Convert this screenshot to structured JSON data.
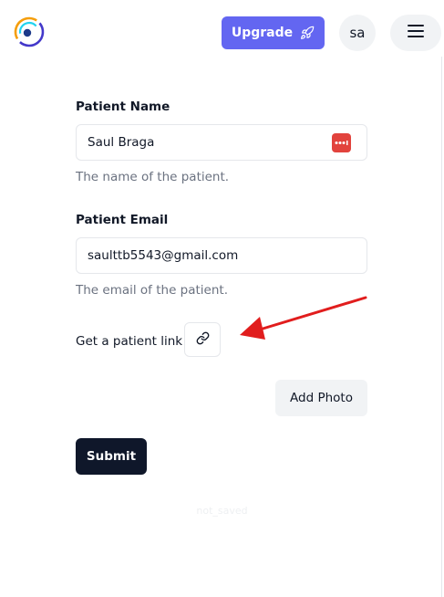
{
  "header": {
    "logo_icon": "app-logo-icon",
    "upgrade_label": "Upgrade",
    "upgrade_icon": "rocket-icon",
    "upgrade_color": "#6366f1",
    "avatar_initials": "sa",
    "menu_icon": "hamburger-menu-icon"
  },
  "form": {
    "patient_name": {
      "label": "Patient Name",
      "value": "Saul Braga",
      "help": "The name of the patient.",
      "icon": "password-manager-icon",
      "icon_color": "#e2433d"
    },
    "patient_email": {
      "label": "Patient Email",
      "value": "saulttb5543@gmail.com",
      "help": "The email of the patient."
    },
    "patient_link": {
      "label": "Get a patient link",
      "icon": "link-icon"
    },
    "add_photo_label": "Add Photo",
    "submit_label": "Submit",
    "submit_color": "#0f172a",
    "status_text": "not_saved"
  },
  "annotation": {
    "arrow_icon": "red-arrow-annotation",
    "arrow_color": "#e11d1d"
  }
}
